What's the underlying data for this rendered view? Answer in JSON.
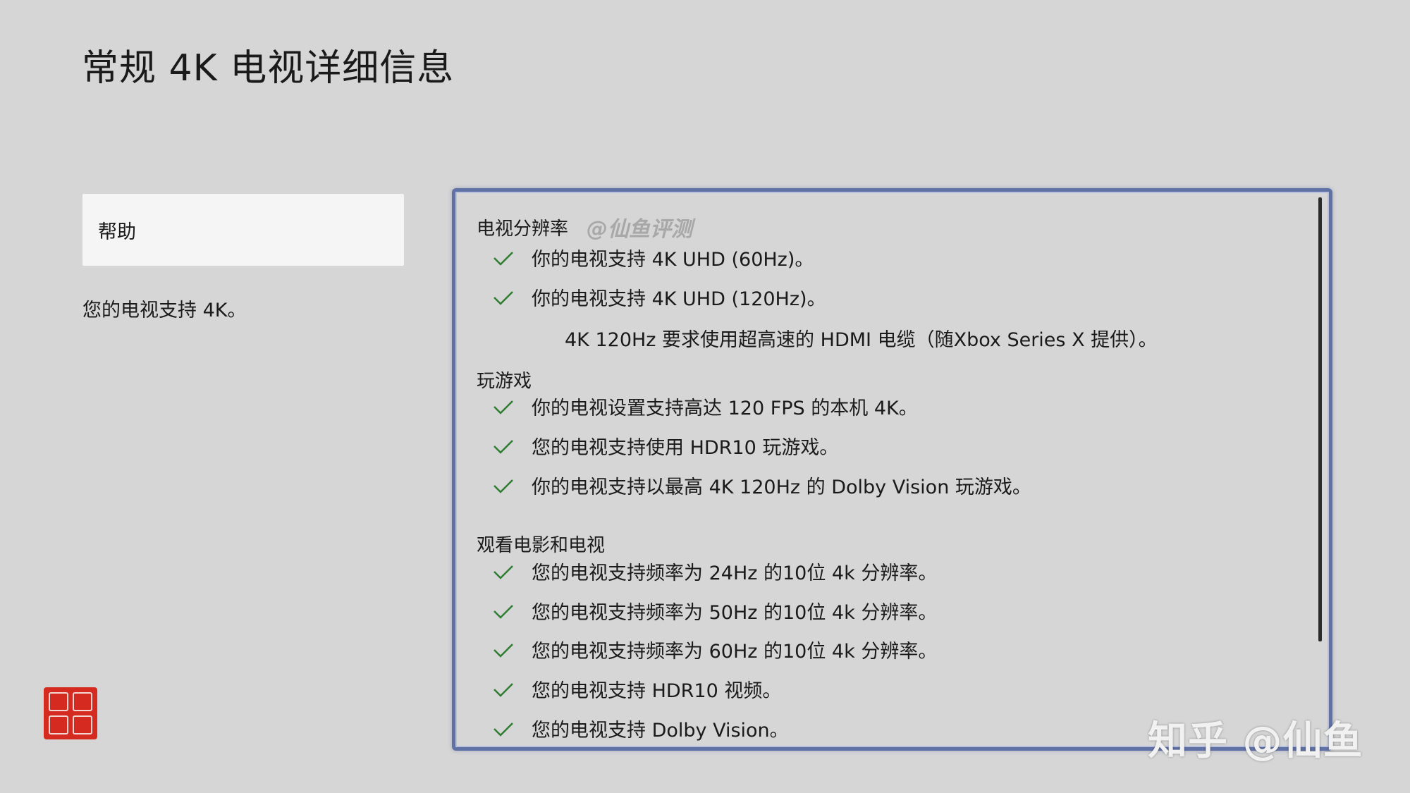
{
  "page": {
    "title": "常规 4K 电视详细信息"
  },
  "sidebar": {
    "help_label": "帮助",
    "status_text": "您的电视支持 4K。"
  },
  "panel": {
    "sections": [
      {
        "heading": "电视分辨率",
        "watermark": "@仙鱼评测",
        "items": [
          "你的电视支持 4K UHD (60Hz)。",
          "你的电视支持 4K UHD (120Hz)。"
        ],
        "note": "4K 120Hz 要求使用超高速的 HDMI 电缆（随Xbox Series X 提供）。"
      },
      {
        "heading": "玩游戏",
        "items": [
          "你的电视设置支持高达 120 FPS 的本机 4K。",
          "您的电视支持使用 HDR10 玩游戏。",
          "你的电视支持以最高 4K 120Hz 的 Dolby Vision 玩游戏。"
        ]
      },
      {
        "heading": "观看电影和电视",
        "items": [
          "您的电视支持频率为 24Hz 的10位 4k 分辨率。",
          "您的电视支持频率为 50Hz 的10位 4k 分辨率。",
          "您的电视支持频率为 60Hz 的10位 4k 分辨率。",
          "您的电视支持 HDR10 视频。",
          "您的电视支持 Dolby Vision。"
        ]
      }
    ]
  },
  "overlay": {
    "zhihu_watermark": "知乎 @仙鱼"
  },
  "colors": {
    "background": "#d6d6d6",
    "focus_border": "#6071a6",
    "check": "#2e7d32",
    "seal": "#d42a20"
  }
}
